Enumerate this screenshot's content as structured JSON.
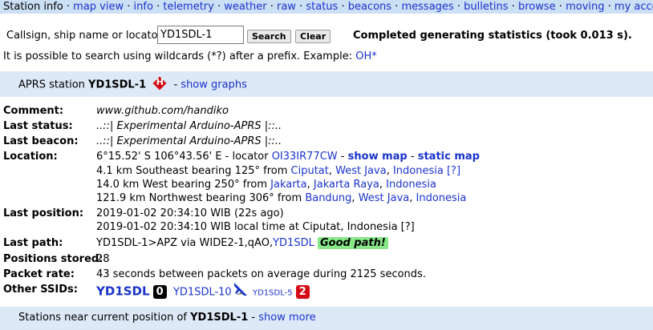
{
  "nav": {
    "items": [
      "Station info",
      "map view",
      "info",
      "telemetry",
      "weather",
      "raw",
      "status",
      "beacons",
      "messages",
      "bulletins",
      "browse",
      "moving",
      "my account"
    ],
    "separator": "·"
  },
  "search": {
    "label": "Callsign, ship name or locator:",
    "value": "YD1SDL-1",
    "search_button": "Search",
    "clear_button": "Clear",
    "status": "Completed generating statistics (took 0.013 s).",
    "wildcard_text": "It is possible to search using wildcards (*?) after a prefix. Example:",
    "wildcard_example": "OH*"
  },
  "station": {
    "prefix": "APRS station",
    "callsign": "YD1SDL-1",
    "symbol": "H",
    "graphs_sep": "-",
    "graphs_link": "show graphs"
  },
  "details": {
    "comment": {
      "key": "Comment:",
      "value": "www.github.com/handiko"
    },
    "last_status": {
      "key": "Last status:",
      "value": "..::| Experimental Arduino-APRS |::.."
    },
    "last_beacon": {
      "key": "Last beacon:",
      "value": "..::| Experimental Arduino-APRS |::.."
    },
    "location": {
      "key": "Location:",
      "coords": "6°15.52' S 106°43.56' E - locator",
      "locator": "OI33IR77CW",
      "sep": "-",
      "show_map": "show map",
      "static_map": "static map",
      "near": [
        {
          "text": "4.1 km Southeast bearing 125° from",
          "place": "Ciputat",
          "region": "West Java",
          "country": "Indonesia",
          "extra": "[?]"
        },
        {
          "text": "14.0 km West bearing 250° from",
          "place": "Jakarta",
          "region": "Jakarta Raya",
          "country": "Indonesia",
          "extra": ""
        },
        {
          "text": "121.9 km Northwest bearing 306° from",
          "place": "Bandung",
          "region": "West Java",
          "country": "Indonesia",
          "extra": ""
        }
      ]
    },
    "last_position": {
      "key": "Last position:",
      "line1": "2019-01-02 20:34:10 WIB (22s ago)",
      "line2": "2019-01-02 20:34:10 WIB local time at Ciputat, Indonesia [?]"
    },
    "last_path": {
      "key": "Last path:",
      "path": "YD1SDL-1>APZ via WIDE2-1,qAO,",
      "igate": "YD1SDL",
      "badge": "Good path!"
    },
    "positions_stored": {
      "key": "Positions stored:",
      "value": "28"
    },
    "packet_rate": {
      "key": "Packet rate:",
      "value": "43 seconds between packets on average during 2125 seconds."
    },
    "other_ssids": {
      "key": "Other SSIDs:",
      "items": [
        {
          "call": "YD1SDL",
          "badge": "0",
          "badge_color": "#000000"
        },
        {
          "call": "YD1SDL-10",
          "badge": "",
          "badge_color": ""
        },
        {
          "call": "YD1SDL-5",
          "badge": "2",
          "badge_color": "#d40b16"
        }
      ]
    }
  },
  "nearby": {
    "prefix": "Stations near current position of",
    "callsign": "YD1SDL-1",
    "sep": "-",
    "link": "show more"
  },
  "colors": {
    "nav_bg": "#cbdff5",
    "band_bg": "#dde9f7",
    "link": "#1a33cc",
    "good_path": "#88e888",
    "symbol_red": "#d40b16"
  }
}
